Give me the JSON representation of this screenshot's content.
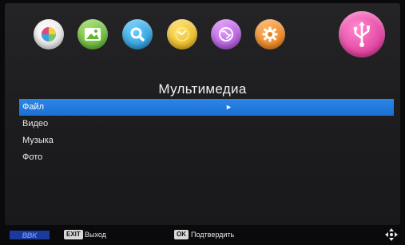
{
  "menu": {
    "title": "Мультимедиа",
    "items": [
      {
        "label": "Файл",
        "selected": true,
        "arrow": "►"
      },
      {
        "label": "Видео"
      },
      {
        "label": "Музыка"
      },
      {
        "label": "Фото"
      }
    ]
  },
  "icons": [
    {
      "name": "picture-icon",
      "color": "#f2f2f2"
    },
    {
      "name": "image-icon",
      "color": "#6cc23a"
    },
    {
      "name": "search-icon",
      "color": "#2aa0e0"
    },
    {
      "name": "clock-icon",
      "color": "#f0c21a"
    },
    {
      "name": "globe-icon",
      "color": "#b25ad6"
    },
    {
      "name": "settings-icon",
      "color": "#f08a1e"
    },
    {
      "name": "usb-icon",
      "color": "#e8409c",
      "active": true
    }
  ],
  "footer": {
    "brand": "BBK",
    "exit_key": "EXIT",
    "exit_label": "Выход",
    "ok_key": "OK",
    "ok_label": "Подтвердить"
  },
  "colors": {
    "selection": "#2a82e4",
    "background": "#1c1c1e"
  }
}
